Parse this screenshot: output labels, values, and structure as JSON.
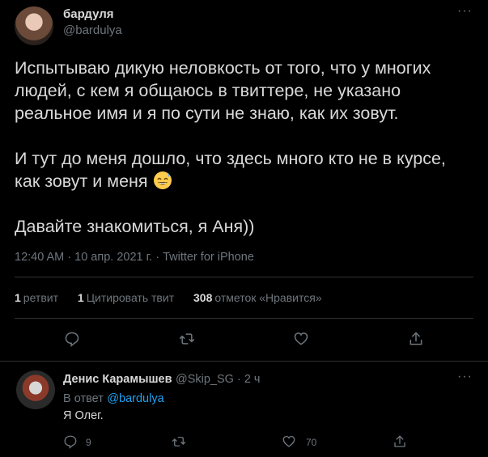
{
  "tweet": {
    "author_name": "бардуля",
    "author_handle": "@bardulya",
    "more_label": "···",
    "paragraph1": "Испытываю дикую неловкость от того, что у многих людей, с кем я общаюсь в твиттере, не указано реальное имя и я по сути не знаю, как их зовут.",
    "paragraph2": "И тут до меня дошло, что здесь много кто не в курсе, как зовут и меня",
    "paragraph3": "Давайте знакомиться, я Аня))",
    "meta": "12:40 AM · 10 апр. 2021 г. · Twitter for iPhone"
  },
  "stats": {
    "retweets_count": "1",
    "retweets_label": "ретвит",
    "quotes_count": "1",
    "quotes_label": "Цитировать твит",
    "likes_count": "308",
    "likes_label": "отметок «Нравится»"
  },
  "icons": {
    "reply": "reply-icon",
    "retweet": "retweet-icon",
    "like": "heart-icon",
    "share": "share-icon",
    "emoji": "grinning-sweat-emoji"
  },
  "reply": {
    "author_name": "Денис Карамышев",
    "author_handle": "@Skip_SG",
    "time": " · 2 ч",
    "more_label": "···",
    "in_reply_prefix": "В ответ",
    "in_reply_handle": "@bardulya",
    "text": "Я Олег.",
    "reply_count": "9",
    "like_count": "70"
  },
  "colors": {
    "background": "#000000",
    "text": "#d9d9d9",
    "secondary": "#6e767d",
    "accent": "#1da1f2",
    "divider": "#2f3336"
  }
}
